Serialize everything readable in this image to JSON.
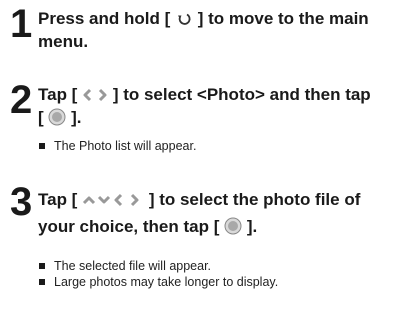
{
  "steps": [
    {
      "number": "1",
      "line1_pre": "Press and hold [",
      "line1_post": "] to move to the main",
      "line2": "menu.",
      "icon": "back-arrow-icon"
    },
    {
      "number": "2",
      "line1_pre": "Tap [",
      "line1_post": "] to select <Photo> and then tap",
      "line2_pre": "[",
      "line2_post": "].",
      "icons": [
        "left-right-arrows-icon",
        "select-button-icon"
      ],
      "bullets": [
        "The Photo list will appear."
      ]
    },
    {
      "number": "3",
      "line1_pre": "Tap [",
      "line1_post": "] to select the photo file of",
      "line2_pre": "your choice, then tap [",
      "line2_post": "].",
      "icons": [
        "up-down-left-right-arrows-icon",
        "select-button-icon"
      ],
      "bullets": [
        "The selected file will appear.",
        "Large photos may take longer to display."
      ]
    }
  ]
}
